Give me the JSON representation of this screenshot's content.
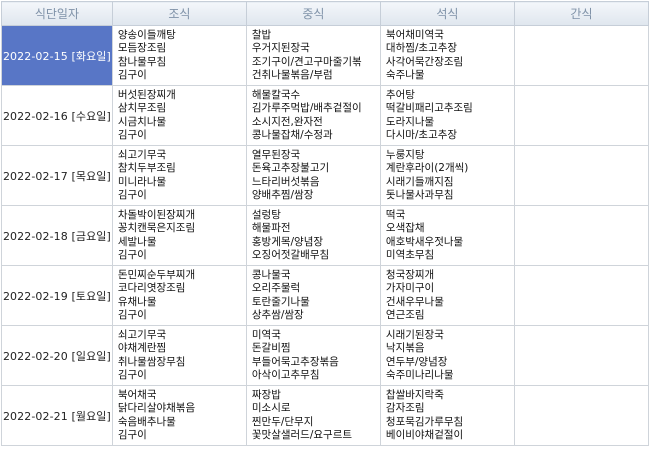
{
  "headers": [
    "식단일자",
    "조식",
    "중식",
    "석식",
    "간식"
  ],
  "accent": "#5876c6",
  "days": [
    {
      "date": "2022-02-15 [화요일]",
      "selected": true,
      "breakfast": [
        "양송이들깨탕",
        "모듬장조림",
        "참나물무침",
        "김구이"
      ],
      "lunch": [
        "찰밥",
        "우거지된장국",
        "조기구이/견고구마줄기볶",
        "건취나물볶음/부럼"
      ],
      "dinner": [
        "북어채미역국",
        "대하찜/초고추장",
        "사각어묵간장조림",
        "숙주나물"
      ]
    },
    {
      "date": "2022-02-16 [수요일]",
      "selected": false,
      "breakfast": [
        "버섯된장찌개",
        "삼치무조림",
        "시금치나물",
        "김구이"
      ],
      "lunch": [
        "해물칼국수",
        "김가루주먹밥/배추겉절이",
        "소시지전,완자전",
        "콩나물잡채/수정과"
      ],
      "dinner": [
        "추어탕",
        "떡갈비패리고추조림",
        "도라지나물",
        "다시마/초고추장"
      ]
    },
    {
      "date": "2022-02-17 [목요일]",
      "selected": false,
      "breakfast": [
        "쇠고기무국",
        "참치두부조림",
        "미니라나물",
        "김구이"
      ],
      "lunch": [
        "열무된장국",
        "돈육고추장불고기",
        "느타리버섯볶음",
        "양배추찜/쌈장"
      ],
      "dinner": [
        "누룽지탕",
        "계란후라이(2개씩)",
        "시래기들깨지짐",
        "돗나물사과무침"
      ]
    },
    {
      "date": "2022-02-18 [금요일]",
      "selected": false,
      "breakfast": [
        "차돌박이된장찌개",
        "꽁치캔묵은지조림",
        "세발나물",
        "김구이"
      ],
      "lunch": [
        "설렁탕",
        "해물파전",
        "홍방게목/양념장",
        "오징어젓갈배무침"
      ],
      "dinner": [
        "떡국",
        "오색잡채",
        "애호박새우젓나물",
        "미역초무침"
      ]
    },
    {
      "date": "2022-02-19 [토요일]",
      "selected": false,
      "breakfast": [
        "돈민찌순두부찌개",
        "코다리엿장조림",
        "유채나물",
        "김구이"
      ],
      "lunch": [
        "콩나물국",
        "오리주물럭",
        "토란줄기나물",
        "상추쌈/쌈장"
      ],
      "dinner": [
        "청국장찌개",
        "가자미구이",
        "건새우무나물",
        "연근조림"
      ]
    },
    {
      "date": "2022-02-20 [일요일]",
      "selected": false,
      "breakfast": [
        "쇠고기무국",
        "야채계란찜",
        "취나물쌈장무침",
        "김구이"
      ],
      "lunch": [
        "미역국",
        "돈갈비찜",
        "부들어묵고추장볶음",
        "아삭이고추무침"
      ],
      "dinner": [
        "시래기된장국",
        "낙지볶음",
        "연두부/양념장",
        "숙주미나리나물"
      ]
    },
    {
      "date": "2022-02-21 [월요일]",
      "selected": false,
      "breakfast": [
        "북어채국",
        "닭다리살야채볶음",
        "숙음배추나물",
        "김구이"
      ],
      "lunch": [
        "짜장밥",
        "미소시로",
        "찐만두/단무지",
        "꽃맛살샐러드/요구르트"
      ],
      "dinner": [
        "찹쌀바지락죽",
        "감자조림",
        "청포묵김가루무침",
        "베이비야채겉절이"
      ]
    }
  ]
}
